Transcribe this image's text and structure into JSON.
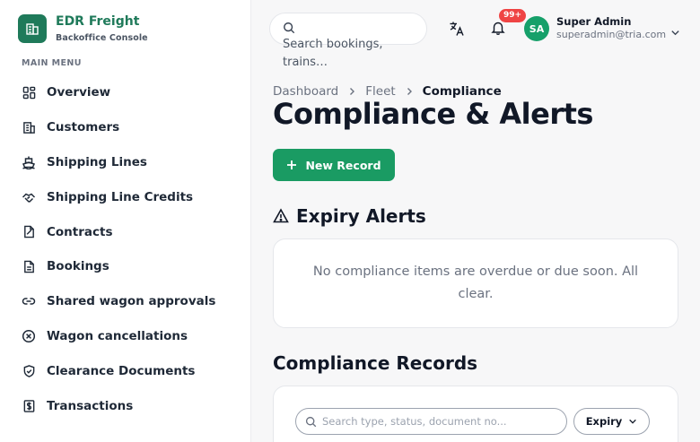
{
  "brand": {
    "name": "EDR Freight",
    "subtitle": "Backoffice Console",
    "icon": "building-icon",
    "color": "#1f7a5a"
  },
  "sidebar": {
    "heading": "MAIN MENU",
    "items": [
      {
        "label": "Overview",
        "icon": "dashboard-grid-icon"
      },
      {
        "label": "Customers",
        "icon": "building-icon"
      },
      {
        "label": "Shipping Lines",
        "icon": "ship-icon"
      },
      {
        "label": "Shipping Line Credits",
        "icon": "handshake-icon"
      },
      {
        "label": "Contracts",
        "icon": "contract-icon"
      },
      {
        "label": "Bookings",
        "icon": "document-icon"
      },
      {
        "label": "Shared wagon approvals",
        "icon": "link-icon"
      },
      {
        "label": "Wagon cancellations",
        "icon": "cancel-circle-icon"
      },
      {
        "label": "Clearance Documents",
        "icon": "shield-check-icon"
      },
      {
        "label": "Transactions",
        "icon": "dollar-receipt-icon"
      }
    ]
  },
  "header": {
    "search_placeholder": "Search bookings, trains…",
    "notification_badge": "99+",
    "user": {
      "initials": "SA",
      "name": "Super Admin",
      "email": "superadmin@tria.com"
    }
  },
  "breadcrumb": [
    "Dashboard",
    "Fleet",
    "Compliance"
  ],
  "page": {
    "title": "Compliance & Alerts",
    "new_record_label": "New Record",
    "expiry_section_title": "Expiry Alerts",
    "expiry_empty_message": "No compliance items are overdue or due soon. All clear.",
    "records_section_title": "Compliance Records",
    "records_search_placeholder": "Search type, status, document no...",
    "records_filter_label": "Expiry"
  },
  "colors": {
    "accent": "#1a9b63",
    "badge": "#ef4444",
    "avatar": "#16a06a"
  }
}
